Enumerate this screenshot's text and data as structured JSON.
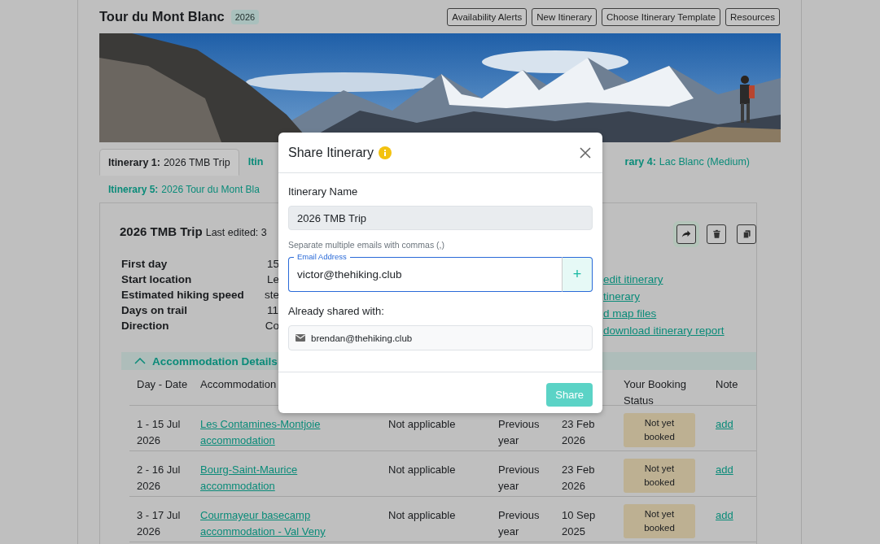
{
  "header": {
    "title": "Tour du Mont Blanc",
    "badge": "2026",
    "buttons": [
      "Availability Alerts",
      "New Itinerary",
      "Choose Itinerary Template",
      "Resources"
    ]
  },
  "tab_rows": [
    {
      "left": [
        {
          "prefix": "Itinerary 1:",
          "label": "2026 TMB Trip",
          "selected": true
        },
        {
          "prefix": "Itin",
          "selected": false
        }
      ],
      "right": [
        {
          "prefix": "rary 4:",
          "label": "Lac Blanc (Medium)",
          "selected": false
        }
      ]
    },
    {
      "left": [
        {
          "prefix": "Itinerary 5:",
          "label": "2026 Tour du Mont Bla",
          "selected": false
        }
      ],
      "right": []
    }
  ],
  "itinerary": {
    "title": "2026 TMB Trip",
    "last_edited": "Last edited: 3",
    "actions": [
      {
        "kind": "share",
        "highlighted": true
      },
      {
        "kind": "delete",
        "highlighted": false
      },
      {
        "kind": "copy",
        "highlighted": false
      }
    ],
    "details": [
      {
        "label": "First day",
        "value": "15"
      },
      {
        "label": "Start location",
        "value": "Le"
      },
      {
        "label": "Estimated hiking speed",
        "value": "ste"
      },
      {
        "label": "Days on trail",
        "value": "11"
      },
      {
        "label": "Direction",
        "value": "Co"
      }
    ],
    "links": [
      "edit itinerary",
      "tinerary",
      "d map files",
      "download itinerary report"
    ]
  },
  "accommodation": {
    "title": "Accommodation Details",
    "expanded": true,
    "columns_left": [
      "Day - Date",
      "Accommodation"
    ],
    "columns_right": [
      "Your Booking Status",
      "Note"
    ],
    "rows": [
      {
        "day_date": "1 - 15 Jul 2026",
        "accommodation": "Les Contamines-Montjoie accommodation",
        "column_3": "Not applicable",
        "column_4": "Previous year",
        "column_5": "23 Feb 2026",
        "booking_status": "Not yet booked",
        "note": "add"
      },
      {
        "day_date": "2 - 16 Jul 2026",
        "accommodation": "Bourg-Saint-Maurice accommodation",
        "column_3": "Not applicable",
        "column_4": "Previous year",
        "column_5": "23 Feb 2026",
        "booking_status": "Not yet booked",
        "note": "add"
      },
      {
        "day_date": "3 - 17 Jul 2026",
        "accommodation": "Courmayeur basecamp accommodation - Val Veny",
        "column_3": "Not applicable",
        "column_4": "Previous year",
        "column_5": "10 Sep 2025",
        "booking_status": "Not yet booked",
        "note": "add"
      }
    ]
  },
  "modal": {
    "title": "Share Itinerary",
    "name_label": "Itinerary Name",
    "name_value": "2026 TMB Trip",
    "help": "Separate multiple emails with commas (,)",
    "email_label": "Email Address",
    "email_value": "victor@thehiking.club",
    "add_button": "+",
    "shared_label": "Already shared with:",
    "shared": [
      "brendan@thehiking.club"
    ],
    "share_button": {
      "label": "Share",
      "disabled": true
    }
  }
}
